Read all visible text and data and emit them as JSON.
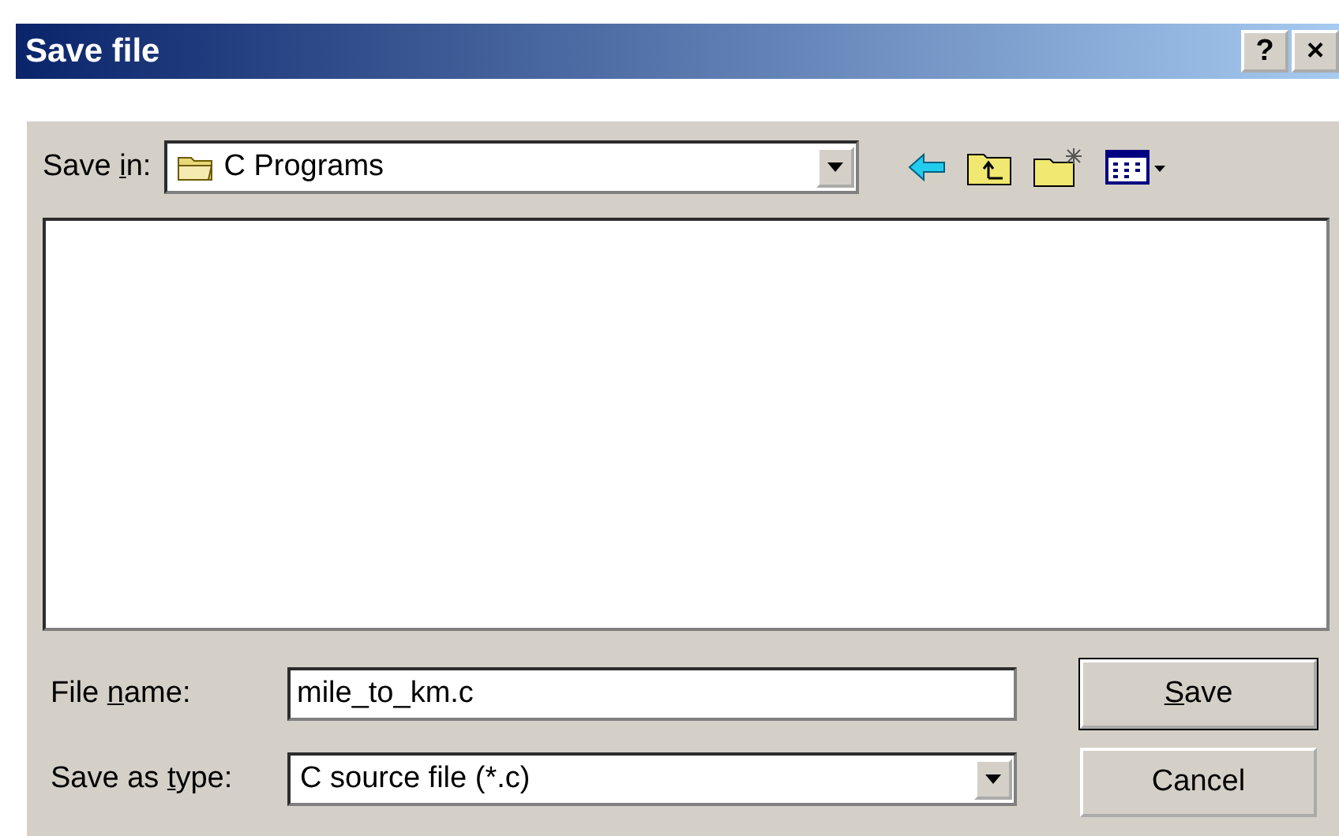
{
  "window": {
    "title": "Save file",
    "buttons": [
      "?",
      "×"
    ]
  },
  "save_in": {
    "label": {
      "pre": "Save ",
      "key": "i",
      "post": "n:"
    },
    "value": "C Programs"
  },
  "file_name": {
    "label": {
      "pre": "File ",
      "key": "n",
      "post": "ame:"
    },
    "value": "mile_to_km.c"
  },
  "save_as_type": {
    "label": {
      "pre": "Save as ",
      "key": "t",
      "post": "ype:"
    },
    "value": "C source file (*.c)"
  },
  "buttons": [
    {
      "label": {
        "key": "S",
        "post": "ave"
      },
      "default": true
    },
    {
      "label": {
        "pre": "Cancel"
      },
      "default": false
    }
  ]
}
